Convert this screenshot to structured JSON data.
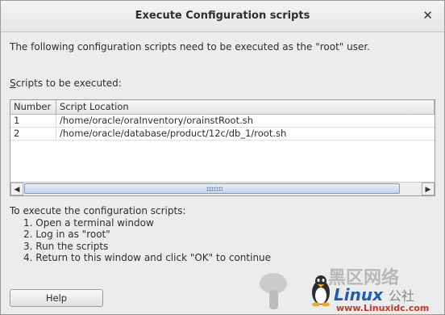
{
  "dialog": {
    "title": "Execute Configuration scripts",
    "close_glyph": "✕",
    "intro": "The following configuration scripts need to be executed as the \"root\" user.",
    "scripts_label_mnemonic": "S",
    "scripts_label_rest": "cripts to be executed:"
  },
  "table": {
    "columns": [
      "Number",
      "Script Location"
    ],
    "rows": [
      {
        "number": "1",
        "location": "/home/oracle/oraInventory/orainstRoot.sh"
      },
      {
        "number": "2",
        "location": "/home/oracle/database/product/12c/db_1/root.sh"
      }
    ],
    "scroll_left_glyph": "◀",
    "scroll_right_glyph": "▶"
  },
  "instructions": {
    "heading": "To execute the configuration scripts:",
    "steps": [
      "1. Open a terminal window",
      "2. Log in as \"root\"",
      "3. Run the scripts",
      "4. Return to this window and click \"OK\" to continue"
    ]
  },
  "buttons": {
    "help_label": "Help"
  },
  "watermark": {
    "line1": "黑区网络",
    "brand": "Linux",
    "brand_suffix": "公社",
    "url": "www.Linuxidc.com",
    "icon": "penguin-icon"
  }
}
